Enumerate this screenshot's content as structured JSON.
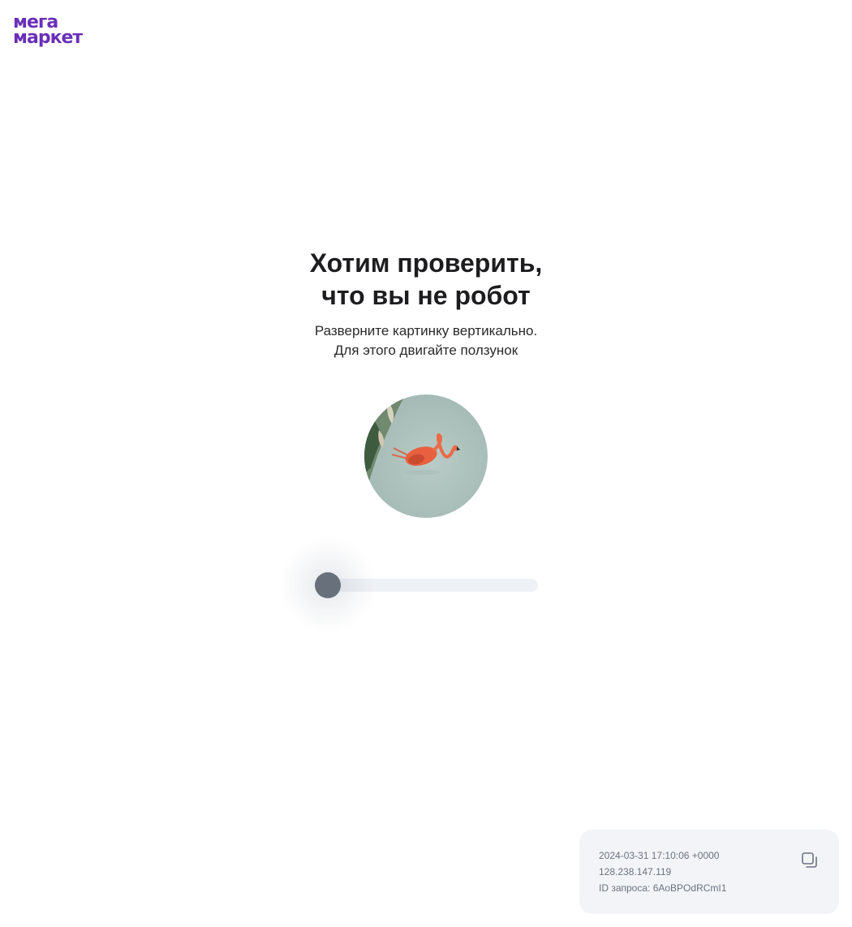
{
  "header": {
    "logo_line1": "мега",
    "logo_line2": "маркет",
    "brand_color": "#6a2fb8"
  },
  "main": {
    "title_line1": "Хотим проверить,",
    "title_line2": "что вы не робот",
    "subtitle_line1": "Разверните картинку вертикально.",
    "subtitle_line2": "Для этого двигайте ползунок",
    "image_subject": "flamingo",
    "slider_value": 0
  },
  "info_card": {
    "timestamp": "2024-03-31 17:10:06 +0000",
    "ip": "128.238.147.119",
    "request_id": "ID запроса: 6AoBPOdRCmI1",
    "copy_icon": "copy-icon"
  }
}
